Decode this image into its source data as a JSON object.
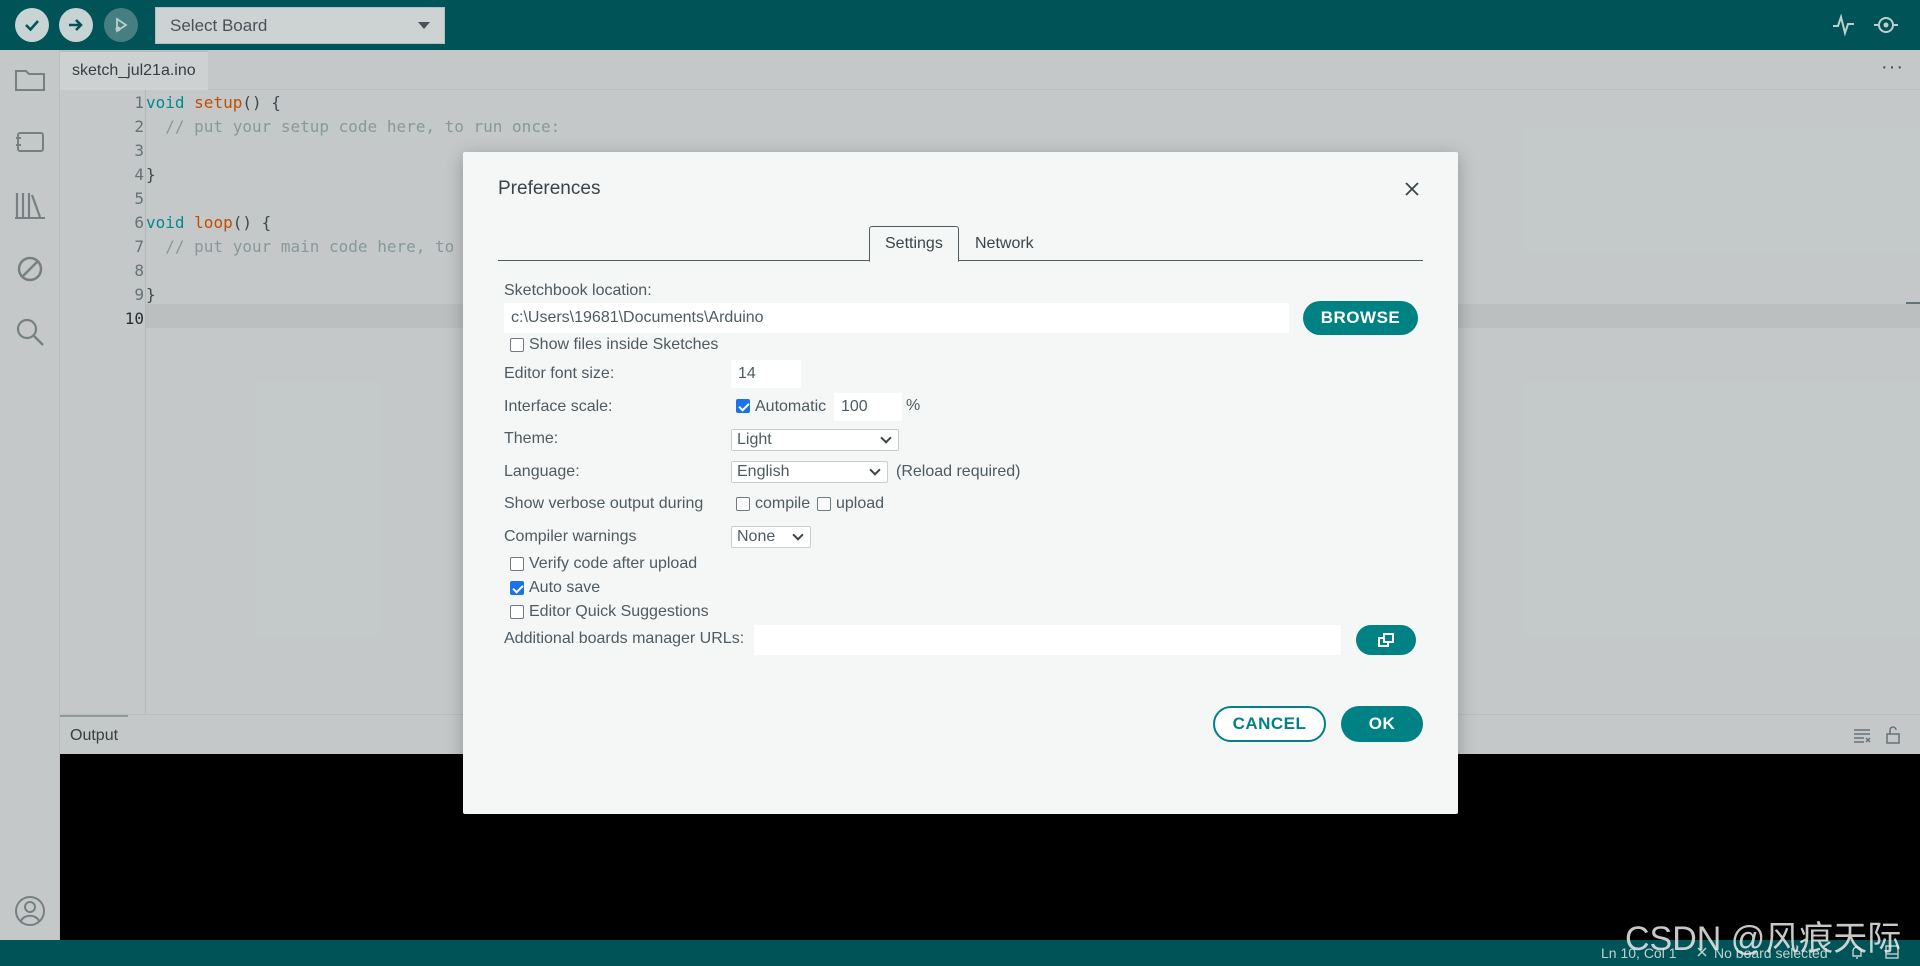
{
  "toolbar": {
    "board_select": "Select Board",
    "icons": [
      "verify-icon",
      "upload-icon",
      "debug-icon",
      "serial-plotter-icon",
      "serial-monitor-icon"
    ]
  },
  "sidebar": {
    "icons": [
      "sketchbook-icon",
      "boards-manager-icon",
      "library-manager-icon",
      "debug-icon",
      "search-icon",
      "account-icon"
    ]
  },
  "editor": {
    "tab": "sketch_jul21a.ino",
    "line_numbers": [
      "1",
      "2",
      "3",
      "4",
      "5",
      "6",
      "7",
      "8",
      "9",
      "10"
    ],
    "current_line": "10",
    "code": {
      "l1_kw": "void",
      "l1_fn": "setup",
      "l1_rest": "() {",
      "l2": "  // put your setup code here, to run once:",
      "l4": "}",
      "l6_kw": "void",
      "l6_fn": "loop",
      "l6_rest": "() {",
      "l7": "  // put your main code here, to",
      "l9": "}"
    }
  },
  "output": {
    "tab": "Output"
  },
  "status": {
    "position": "Ln 10, Col 1",
    "board": "No board selected",
    "watermark": "CSDN @风痕天际"
  },
  "dialog": {
    "title": "Preferences",
    "tabs": [
      "Settings",
      "Network"
    ],
    "active_tab": "Settings",
    "sketchbook_label": "Sketchbook location:",
    "sketchbook_value": "c:\\Users\\19681\\Documents\\Arduino",
    "browse_label": "BROWSE",
    "show_files_label": "Show files inside Sketches",
    "show_files_checked": false,
    "font_size_label": "Editor font size:",
    "font_size_value": "14",
    "scale_label": "Interface scale:",
    "automatic_label": "Automatic",
    "automatic_checked": true,
    "scale_value": "100",
    "scale_unit": "%",
    "theme_label": "Theme:",
    "theme_value": "Light",
    "language_label": "Language:",
    "language_value": "English",
    "language_note": "(Reload required)",
    "verbose_label": "Show verbose output during",
    "compile_label": "compile",
    "compile_checked": false,
    "upload_label": "upload",
    "upload_checked": false,
    "warnings_label": "Compiler warnings",
    "warnings_value": "None",
    "verify_label": "Verify code after upload",
    "verify_checked": false,
    "autosave_label": "Auto save",
    "autosave_checked": true,
    "quick_suggestions_label": "Editor Quick Suggestions",
    "quick_suggestions_checked": false,
    "urls_label": "Additional boards manager URLs:",
    "urls_value": "",
    "cancel_label": "CANCEL",
    "ok_label": "OK"
  },
  "colors": {
    "brand": "#005c5f",
    "accent": "#008184",
    "checkbox": "#1a73e8"
  }
}
